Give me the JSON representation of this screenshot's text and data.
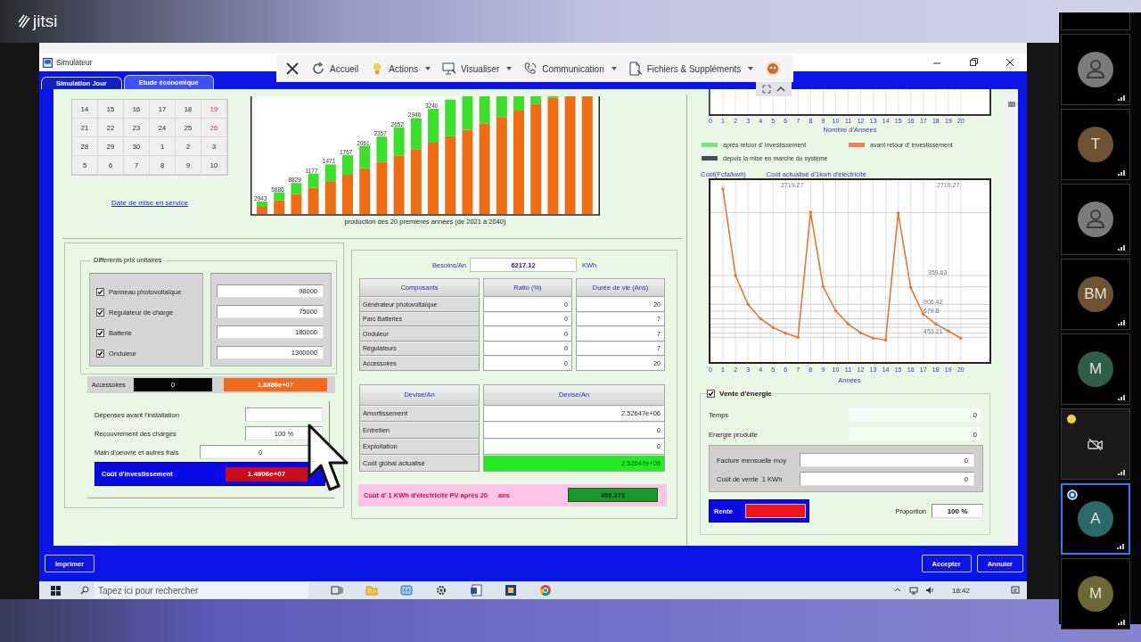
{
  "app": {
    "logo": "jitsi"
  },
  "window": {
    "title": "Simulateur"
  },
  "remote_toolbar": [
    {
      "kind": "close"
    },
    {
      "kind": "menu",
      "label": "Accueil",
      "dropdown": false
    },
    {
      "kind": "menu",
      "label": "Actions",
      "dropdown": true
    },
    {
      "kind": "menu",
      "label": "Visualiser",
      "dropdown": true
    },
    {
      "kind": "menu",
      "label": "Communication",
      "dropdown": true
    },
    {
      "kind": "menu",
      "label": "Fichiers & Suppléments",
      "dropdown": true
    },
    {
      "kind": "avatar"
    }
  ],
  "tabs": [
    {
      "label": "Simulation Jour",
      "selected": false
    },
    {
      "label": "Etude économique",
      "selected": true
    }
  ],
  "calendar": {
    "weeks": [
      [
        {
          "day": "14",
          "weekend": false
        },
        {
          "day": "15",
          "weekend": false
        },
        {
          "day": "16",
          "weekend": false
        },
        {
          "day": "17",
          "weekend": false
        },
        {
          "day": "18",
          "weekend": false
        },
        {
          "day": "19",
          "weekend": true
        }
      ],
      [
        {
          "day": "21",
          "weekend": false
        },
        {
          "day": "22",
          "weekend": false
        },
        {
          "day": "23",
          "weekend": false
        },
        {
          "day": "24",
          "weekend": false
        },
        {
          "day": "25",
          "weekend": false
        },
        {
          "day": "26",
          "weekend": true
        }
      ],
      [
        {
          "day": "28",
          "weekend": false
        },
        {
          "day": "29",
          "weekend": false
        },
        {
          "day": "30",
          "weekend": false
        },
        {
          "day": "1",
          "weekend": false
        },
        {
          "day": "2",
          "weekend": false
        },
        {
          "day": "3",
          "weekend": false
        }
      ],
      [
        {
          "day": "5",
          "weekend": false
        },
        {
          "day": "6",
          "weekend": false
        },
        {
          "day": "7",
          "weekend": false
        },
        {
          "day": "8",
          "weekend": false
        },
        {
          "day": "9",
          "weekend": false
        },
        {
          "day": "10",
          "weekend": false
        }
      ]
    ],
    "link": "Date de mise en service"
  },
  "production_chart": {
    "bar_labels": [
      "2943",
      "5886",
      "8829",
      "1177",
      "1471",
      "1767",
      "2061",
      "2357",
      "2652",
      "2946",
      "3240"
    ],
    "caption": "production des 20 premieres années (de 2021 à 2040)"
  },
  "unit_prices": {
    "legend": "Differents prix unitaires",
    "items": [
      {
        "label": "Panneau photovoltaïque",
        "checked": true,
        "value": "98000"
      },
      {
        "label": "Régulateur de charge",
        "checked": true,
        "value": "75000"
      },
      {
        "label": "Batterie",
        "checked": true,
        "value": "180000"
      },
      {
        "label": "Onduleur",
        "checked": true,
        "value": "1300000"
      }
    ],
    "accessories": {
      "label": "Accessoires",
      "value": "0",
      "total": "1.8886e+07"
    },
    "fields": [
      {
        "label": "Dépenses avant l'installation"
      },
      {
        "label": "Recouvrement des charges",
        "value": "100 %"
      },
      {
        "label": "Main d'oeuvre et autres frais",
        "value": "0"
      }
    ],
    "investment": {
      "label": "Coût d'investissement",
      "value": "1.4906e+07"
    }
  },
  "needs": {
    "label": "Besoins/An",
    "value": "6217.12",
    "unit": "KWh"
  },
  "components_table": {
    "columns": [
      "Composants",
      "Ratio (%)",
      "Durée de vie (Ans)"
    ],
    "rows": [
      [
        "Générateur photovoltaïque",
        "0",
        "20"
      ],
      [
        "Parc Batteries",
        "0",
        "7"
      ],
      [
        "Onduleur",
        "0",
        "7"
      ],
      [
        "Régulateurs",
        "0",
        "7"
      ],
      [
        "Accessoires",
        "0",
        "20"
      ]
    ]
  },
  "costs_table": {
    "columns": [
      "Devise/An",
      "Devise/An"
    ],
    "rows": [
      {
        "label": "Amortissement",
        "value": "2.52647e+06",
        "highlighted": false
      },
      {
        "label": "Entretien",
        "value": "0",
        "highlighted": false
      },
      {
        "label": "Exploitation",
        "value": "0",
        "highlighted": false
      },
      {
        "label": "Coût global actualisé",
        "value": "2.52647e+06",
        "highlighted": true
      }
    ]
  },
  "kwh_cost": {
    "label": "Coût d' 1 KWh d'électricité PV après 20",
    "unit": "ans",
    "value": "406.373"
  },
  "years_chart": {
    "x_tick_labels": [
      "0",
      "1",
      "2",
      "3",
      "4",
      "5",
      "6",
      "7",
      "8",
      "9",
      "10",
      "11",
      "12",
      "13",
      "14",
      "15",
      "16",
      "17",
      "18",
      "19",
      "20"
    ],
    "xlabel": "Nombre d'Années",
    "legend": [
      {
        "label": "après retour d' investissement",
        "color": "#7ee07e"
      },
      {
        "label": "avant retour d' investissement",
        "color": "#f08055"
      },
      {
        "label": "depuis la mise en marche du système",
        "color": "#4a4a5a"
      }
    ]
  },
  "cost_chart": {
    "ylabel": "Coût(Fcfa/kwh)",
    "title": "Coût actualisé d'1kwh d'électricité",
    "annotations": [
      "2719.27",
      "2719.27",
      "359.63",
      "906.42",
      "679.8",
      "453.21"
    ],
    "x_tick_labels": [
      "0",
      "1",
      "2",
      "3",
      "4",
      "5",
      "6",
      "7",
      "8",
      "9",
      "10",
      "11",
      "12",
      "13",
      "14",
      "15",
      "16",
      "17",
      "18",
      "19",
      "20"
    ],
    "xlabel": "Années"
  },
  "energy_sale": {
    "label": "Vente d'énergie",
    "checked": true,
    "rows": [
      {
        "label": "Temps",
        "value": "0"
      },
      {
        "label": "Energie produite",
        "value": "0"
      }
    ],
    "inputs": [
      {
        "label": "Facture mensuelle moy",
        "value": "0"
      },
      {
        "label": "Coût de vente  1 KWh",
        "value": "0"
      }
    ],
    "rente": "Rente",
    "proportion": {
      "label": "Proportion",
      "value": "100 %"
    }
  },
  "footer": {
    "print": "Imprimer",
    "buttons": [
      "Accepter",
      "Annuler"
    ]
  },
  "taskbar": {
    "search_placeholder": "Tapez ici pour rechercher",
    "time": "18:42"
  },
  "participants": [
    {
      "kind": "avatar",
      "color": "#7b7b7b",
      "selected": false,
      "status_dot": false
    },
    {
      "kind": "initials",
      "initials": "T",
      "color": "#6e5234",
      "selected": false,
      "status_dot": false
    },
    {
      "kind": "avatar",
      "color": "#7b7b7b",
      "selected": false,
      "status_dot": false
    },
    {
      "kind": "initials",
      "initials": "BM",
      "color": "#6e5234",
      "selected": false,
      "status_dot": false
    },
    {
      "kind": "initials",
      "initials": "M",
      "color": "#2e5e4a",
      "selected": false,
      "status_dot": false
    },
    {
      "kind": "camera-off",
      "selected": false,
      "status_dot": true
    },
    {
      "kind": "initials",
      "initials": "A",
      "color": "#2c6a6a",
      "selected": true,
      "status_dot": false
    },
    {
      "kind": "initials",
      "initials": "M",
      "color": "#6a6936",
      "selected": false,
      "status_dot": false
    }
  ]
}
